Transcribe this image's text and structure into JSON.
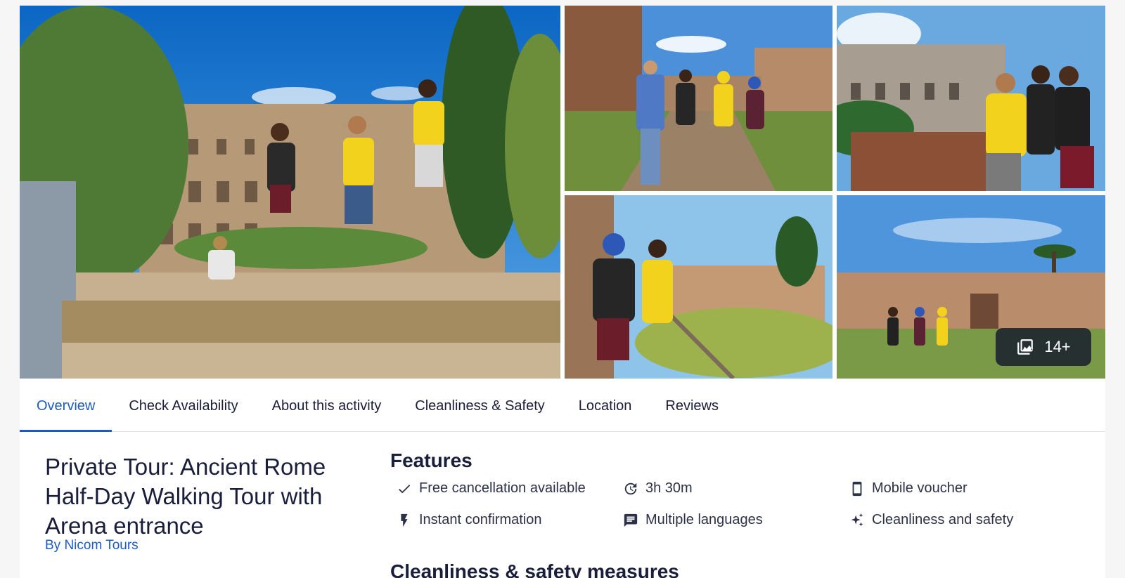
{
  "gallery": {
    "more_photos_label": "14+"
  },
  "tabs": [
    {
      "label": "Overview"
    },
    {
      "label": "Check Availability"
    },
    {
      "label": "About this activity"
    },
    {
      "label": "Cleanliness & Safety"
    },
    {
      "label": "Location"
    },
    {
      "label": "Reviews"
    }
  ],
  "activity": {
    "title": "Private Tour: Ancient Rome Half-Day Walking Tour with Arena entrance",
    "byline": "By Nicom Tours"
  },
  "features": {
    "heading": "Features",
    "items": [
      {
        "label": "Free cancellation available",
        "icon": "checkmark-icon"
      },
      {
        "label": "Instant confirmation",
        "icon": "lightning-icon"
      },
      {
        "label": "3h 30m",
        "icon": "duration-clock-icon"
      },
      {
        "label": "Multiple languages",
        "icon": "chat-bubble-icon"
      },
      {
        "label": "Mobile voucher",
        "icon": "mobile-phone-icon"
      },
      {
        "label": "Cleanliness and safety",
        "icon": "sparkle-icon"
      }
    ]
  },
  "next_section": {
    "heading_partial": "Cleanliness & safety measures"
  }
}
